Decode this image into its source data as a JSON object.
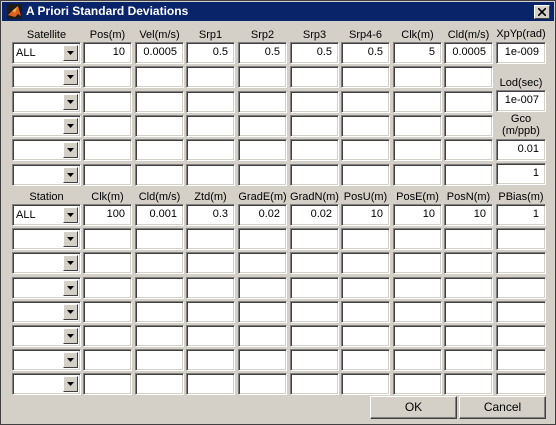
{
  "window": {
    "title": "A Priori Standard Deviations"
  },
  "satellite": {
    "headers": [
      "Satellite",
      "Pos(m)",
      "Vel(m/s)",
      "Srp1",
      "Srp2",
      "Srp3",
      "Srp4-6",
      "Clk(m)",
      "Cld(m/s)"
    ],
    "rows": [
      {
        "combo": "ALL",
        "values": [
          "10",
          "0.0005",
          "0.5",
          "0.5",
          "0.5",
          "0.5",
          "5",
          "0.0005"
        ]
      },
      {
        "combo": "",
        "values": [
          "",
          "",
          "",
          "",
          "",
          "",
          "",
          ""
        ]
      },
      {
        "combo": "",
        "values": [
          "",
          "",
          "",
          "",
          "",
          "",
          "",
          ""
        ]
      },
      {
        "combo": "",
        "values": [
          "",
          "",
          "",
          "",
          "",
          "",
          "",
          ""
        ]
      },
      {
        "combo": "",
        "values": [
          "",
          "",
          "",
          "",
          "",
          "",
          "",
          ""
        ]
      },
      {
        "combo": "",
        "values": [
          "",
          "",
          "",
          "",
          "",
          "",
          "",
          ""
        ]
      }
    ]
  },
  "side": {
    "xpyp_label": "XpYp(rad)",
    "xpyp_value": "1e-009",
    "lod_label": "Lod(sec)",
    "lod_value": "1e-007",
    "gco_label_1": "Gco",
    "gco_label_2": "(m/ppb)",
    "gco_value": "0.01",
    "extra_value": "1"
  },
  "station": {
    "headers": [
      "Station",
      "Clk(m)",
      "Cld(m/s)",
      "Ztd(m)",
      "GradE(m)",
      "GradN(m)",
      "PosU(m)",
      "PosE(m)",
      "PosN(m)",
      "PBias(m)"
    ],
    "rows": [
      {
        "combo": "ALL",
        "values": [
          "100",
          "0.001",
          "0.3",
          "0.02",
          "0.02",
          "10",
          "10",
          "10",
          "1"
        ]
      },
      {
        "combo": "",
        "values": [
          "",
          "",
          "",
          "",
          "",
          "",
          "",
          "",
          ""
        ]
      },
      {
        "combo": "",
        "values": [
          "",
          "",
          "",
          "",
          "",
          "",
          "",
          "",
          ""
        ]
      },
      {
        "combo": "",
        "values": [
          "",
          "",
          "",
          "",
          "",
          "",
          "",
          "",
          ""
        ]
      },
      {
        "combo": "",
        "values": [
          "",
          "",
          "",
          "",
          "",
          "",
          "",
          "",
          ""
        ]
      },
      {
        "combo": "",
        "values": [
          "",
          "",
          "",
          "",
          "",
          "",
          "",
          "",
          ""
        ]
      },
      {
        "combo": "",
        "values": [
          "",
          "",
          "",
          "",
          "",
          "",
          "",
          "",
          ""
        ]
      },
      {
        "combo": "",
        "values": [
          "",
          "",
          "",
          "",
          "",
          "",
          "",
          "",
          ""
        ]
      }
    ]
  },
  "buttons": {
    "ok": "OK",
    "cancel": "Cancel"
  },
  "colors": {
    "titlebar": "#0a246a",
    "face": "#d4d0c8",
    "field": "#ffffff"
  }
}
